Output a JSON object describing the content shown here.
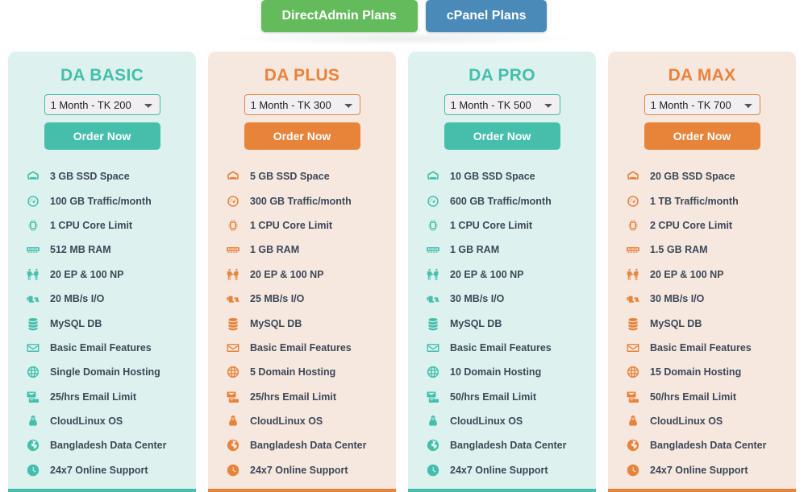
{
  "tabs": [
    {
      "label": "DirectAdmin Plans",
      "color": "#63bb5c",
      "active": true
    },
    {
      "label": "cPanel Plans",
      "color": "#4a8ab9",
      "active": false
    }
  ],
  "order_button_label": "Order Now",
  "theme_colors": {
    "teal_accent": "#45bfac",
    "teal_bg": "#ddf2ef",
    "orange_accent": "#e8833a",
    "orange_bg": "#f6e7df",
    "green_tab": "#63bb5c",
    "blue_tab": "#4a8ab9",
    "feature_text": "#3c4858"
  },
  "plans": [
    {
      "name": "DA BASIC",
      "theme": "teal",
      "term": "1 Month - TK 200",
      "order_label": "Order Now",
      "features": [
        {
          "icon": "hard-drive-icon",
          "text": "3 GB SSD Space"
        },
        {
          "icon": "speedometer-icon",
          "text": "100 GB Traffic/month"
        },
        {
          "icon": "cpu-chip-icon",
          "text": "1 CPU Core Limit"
        },
        {
          "icon": "memory-ram-icon",
          "text": "512 MB RAM"
        },
        {
          "icon": "entry-process-icon",
          "text": "20 EP & 100 NP"
        },
        {
          "icon": "io-signal-icon",
          "text": "20 MB/s I/O"
        },
        {
          "icon": "database-icon",
          "text": "MySQL DB"
        },
        {
          "icon": "envelope-icon",
          "text": "Basic Email Features"
        },
        {
          "icon": "globe-icon",
          "text": "Single Domain Hosting"
        },
        {
          "icon": "mail-stack-icon",
          "text": "25/hrs Email Limit"
        },
        {
          "icon": "linux-penguin-icon",
          "text": "CloudLinux OS"
        },
        {
          "icon": "globe-marker-icon",
          "text": "Bangladesh Data Center"
        },
        {
          "icon": "clock-icon",
          "text": "24x7 Online Support"
        }
      ]
    },
    {
      "name": "DA PLUS",
      "theme": "orange",
      "term": "1 Month - TK 300",
      "order_label": "Order Now",
      "features": [
        {
          "icon": "hard-drive-icon",
          "text": "5 GB SSD Space"
        },
        {
          "icon": "speedometer-icon",
          "text": "300 GB Traffic/month"
        },
        {
          "icon": "cpu-chip-icon",
          "text": "1 CPU Core Limit"
        },
        {
          "icon": "memory-ram-icon",
          "text": "1 GB RAM"
        },
        {
          "icon": "entry-process-icon",
          "text": "20 EP & 100 NP"
        },
        {
          "icon": "io-signal-icon",
          "text": "25 MB/s I/O"
        },
        {
          "icon": "database-icon",
          "text": "MySQL DB"
        },
        {
          "icon": "envelope-icon",
          "text": "Basic Email Features"
        },
        {
          "icon": "globe-icon",
          "text": "5 Domain Hosting"
        },
        {
          "icon": "mail-stack-icon",
          "text": "25/hrs Email Limit"
        },
        {
          "icon": "linux-penguin-icon",
          "text": "CloudLinux OS"
        },
        {
          "icon": "globe-marker-icon",
          "text": "Bangladesh Data Center"
        },
        {
          "icon": "clock-icon",
          "text": "24x7 Online Support"
        }
      ]
    },
    {
      "name": "DA PRO",
      "theme": "teal",
      "term": "1 Month - TK 500",
      "order_label": "Order Now",
      "features": [
        {
          "icon": "hard-drive-icon",
          "text": "10 GB SSD Space"
        },
        {
          "icon": "speedometer-icon",
          "text": "600 GB Traffic/month"
        },
        {
          "icon": "cpu-chip-icon",
          "text": "1 CPU Core Limit"
        },
        {
          "icon": "memory-ram-icon",
          "text": "1 GB RAM"
        },
        {
          "icon": "entry-process-icon",
          "text": "20 EP & 100 NP"
        },
        {
          "icon": "io-signal-icon",
          "text": "30 MB/s I/O"
        },
        {
          "icon": "database-icon",
          "text": "MySQL DB"
        },
        {
          "icon": "envelope-icon",
          "text": "Basic Email Features"
        },
        {
          "icon": "globe-icon",
          "text": "10 Domain Hosting"
        },
        {
          "icon": "mail-stack-icon",
          "text": "50/hrs Email Limit"
        },
        {
          "icon": "linux-penguin-icon",
          "text": "CloudLinux OS"
        },
        {
          "icon": "globe-marker-icon",
          "text": "Bangladesh Data Center"
        },
        {
          "icon": "clock-icon",
          "text": "24x7 Online Support"
        }
      ]
    },
    {
      "name": "DA MAX",
      "theme": "orange",
      "term": "1 Month - TK 700",
      "order_label": "Order Now",
      "features": [
        {
          "icon": "hard-drive-icon",
          "text": "20 GB SSD Space"
        },
        {
          "icon": "speedometer-icon",
          "text": "1 TB Traffic/month"
        },
        {
          "icon": "cpu-chip-icon",
          "text": "2 CPU Core Limit"
        },
        {
          "icon": "memory-ram-icon",
          "text": "1.5 GB RAM"
        },
        {
          "icon": "entry-process-icon",
          "text": "20 EP & 100 NP"
        },
        {
          "icon": "io-signal-icon",
          "text": "30 MB/s I/O"
        },
        {
          "icon": "database-icon",
          "text": "MySQL DB"
        },
        {
          "icon": "envelope-icon",
          "text": "Basic Email Features"
        },
        {
          "icon": "globe-icon",
          "text": "15 Domain Hosting"
        },
        {
          "icon": "mail-stack-icon",
          "text": "50/hrs Email Limit"
        },
        {
          "icon": "linux-penguin-icon",
          "text": "CloudLinux OS"
        },
        {
          "icon": "globe-marker-icon",
          "text": "Bangladesh Data Center"
        },
        {
          "icon": "clock-icon",
          "text": "24x7 Online Support"
        }
      ]
    }
  ]
}
